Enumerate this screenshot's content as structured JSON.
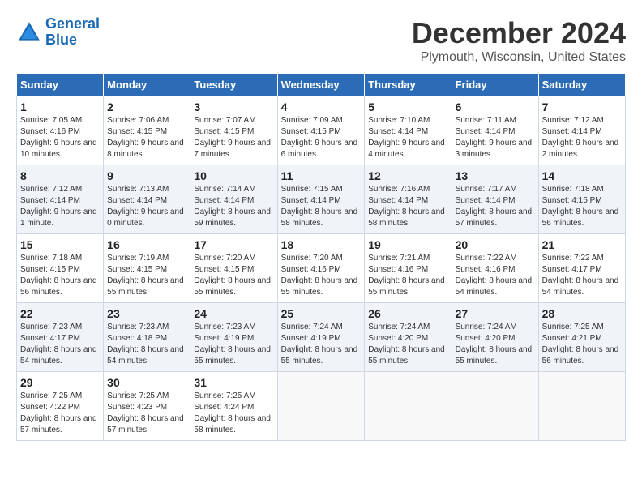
{
  "header": {
    "logo_line1": "General",
    "logo_line2": "Blue",
    "month": "December 2024",
    "location": "Plymouth, Wisconsin, United States"
  },
  "days_of_week": [
    "Sunday",
    "Monday",
    "Tuesday",
    "Wednesday",
    "Thursday",
    "Friday",
    "Saturday"
  ],
  "weeks": [
    [
      {
        "day": "1",
        "sunrise": "7:05 AM",
        "sunset": "4:16 PM",
        "daylight": "9 hours and 10 minutes."
      },
      {
        "day": "2",
        "sunrise": "7:06 AM",
        "sunset": "4:15 PM",
        "daylight": "9 hours and 8 minutes."
      },
      {
        "day": "3",
        "sunrise": "7:07 AM",
        "sunset": "4:15 PM",
        "daylight": "9 hours and 7 minutes."
      },
      {
        "day": "4",
        "sunrise": "7:09 AM",
        "sunset": "4:15 PM",
        "daylight": "9 hours and 6 minutes."
      },
      {
        "day": "5",
        "sunrise": "7:10 AM",
        "sunset": "4:14 PM",
        "daylight": "9 hours and 4 minutes."
      },
      {
        "day": "6",
        "sunrise": "7:11 AM",
        "sunset": "4:14 PM",
        "daylight": "9 hours and 3 minutes."
      },
      {
        "day": "7",
        "sunrise": "7:12 AM",
        "sunset": "4:14 PM",
        "daylight": "9 hours and 2 minutes."
      }
    ],
    [
      {
        "day": "8",
        "sunrise": "7:12 AM",
        "sunset": "4:14 PM",
        "daylight": "9 hours and 1 minute."
      },
      {
        "day": "9",
        "sunrise": "7:13 AM",
        "sunset": "4:14 PM",
        "daylight": "9 hours and 0 minutes."
      },
      {
        "day": "10",
        "sunrise": "7:14 AM",
        "sunset": "4:14 PM",
        "daylight": "8 hours and 59 minutes."
      },
      {
        "day": "11",
        "sunrise": "7:15 AM",
        "sunset": "4:14 PM",
        "daylight": "8 hours and 58 minutes."
      },
      {
        "day": "12",
        "sunrise": "7:16 AM",
        "sunset": "4:14 PM",
        "daylight": "8 hours and 58 minutes."
      },
      {
        "day": "13",
        "sunrise": "7:17 AM",
        "sunset": "4:14 PM",
        "daylight": "8 hours and 57 minutes."
      },
      {
        "day": "14",
        "sunrise": "7:18 AM",
        "sunset": "4:15 PM",
        "daylight": "8 hours and 56 minutes."
      }
    ],
    [
      {
        "day": "15",
        "sunrise": "7:18 AM",
        "sunset": "4:15 PM",
        "daylight": "8 hours and 56 minutes."
      },
      {
        "day": "16",
        "sunrise": "7:19 AM",
        "sunset": "4:15 PM",
        "daylight": "8 hours and 55 minutes."
      },
      {
        "day": "17",
        "sunrise": "7:20 AM",
        "sunset": "4:15 PM",
        "daylight": "8 hours and 55 minutes."
      },
      {
        "day": "18",
        "sunrise": "7:20 AM",
        "sunset": "4:16 PM",
        "daylight": "8 hours and 55 minutes."
      },
      {
        "day": "19",
        "sunrise": "7:21 AM",
        "sunset": "4:16 PM",
        "daylight": "8 hours and 55 minutes."
      },
      {
        "day": "20",
        "sunrise": "7:22 AM",
        "sunset": "4:16 PM",
        "daylight": "8 hours and 54 minutes."
      },
      {
        "day": "21",
        "sunrise": "7:22 AM",
        "sunset": "4:17 PM",
        "daylight": "8 hours and 54 minutes."
      }
    ],
    [
      {
        "day": "22",
        "sunrise": "7:23 AM",
        "sunset": "4:17 PM",
        "daylight": "8 hours and 54 minutes."
      },
      {
        "day": "23",
        "sunrise": "7:23 AM",
        "sunset": "4:18 PM",
        "daylight": "8 hours and 54 minutes."
      },
      {
        "day": "24",
        "sunrise": "7:23 AM",
        "sunset": "4:19 PM",
        "daylight": "8 hours and 55 minutes."
      },
      {
        "day": "25",
        "sunrise": "7:24 AM",
        "sunset": "4:19 PM",
        "daylight": "8 hours and 55 minutes."
      },
      {
        "day": "26",
        "sunrise": "7:24 AM",
        "sunset": "4:20 PM",
        "daylight": "8 hours and 55 minutes."
      },
      {
        "day": "27",
        "sunrise": "7:24 AM",
        "sunset": "4:20 PM",
        "daylight": "8 hours and 55 minutes."
      },
      {
        "day": "28",
        "sunrise": "7:25 AM",
        "sunset": "4:21 PM",
        "daylight": "8 hours and 56 minutes."
      }
    ],
    [
      {
        "day": "29",
        "sunrise": "7:25 AM",
        "sunset": "4:22 PM",
        "daylight": "8 hours and 57 minutes."
      },
      {
        "day": "30",
        "sunrise": "7:25 AM",
        "sunset": "4:23 PM",
        "daylight": "8 hours and 57 minutes."
      },
      {
        "day": "31",
        "sunrise": "7:25 AM",
        "sunset": "4:24 PM",
        "daylight": "8 hours and 58 minutes."
      },
      null,
      null,
      null,
      null
    ]
  ],
  "labels": {
    "sunrise": "Sunrise:",
    "sunset": "Sunset:",
    "daylight": "Daylight:"
  }
}
